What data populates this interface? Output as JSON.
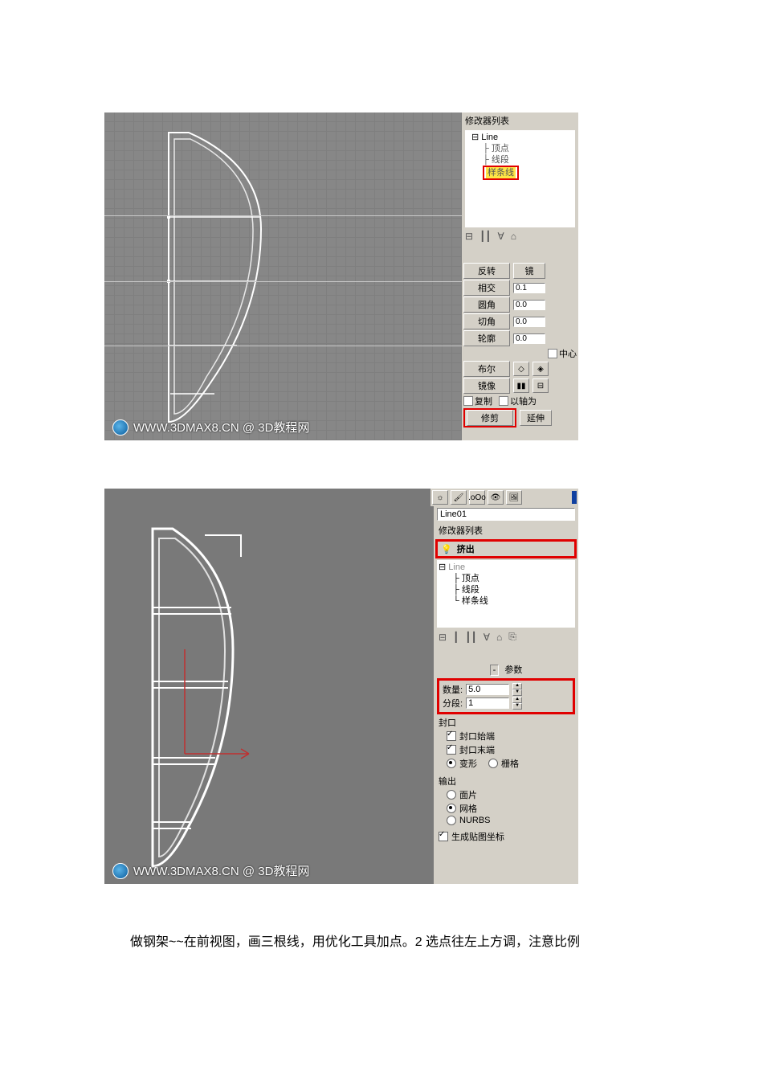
{
  "shot1": {
    "panel_title": "修改器列表",
    "stack": {
      "root": "Line",
      "sub1": "顶点",
      "sub2": "线段",
      "sub3_highlight": "样条线"
    },
    "toolbar_icons": [
      "⊟",
      "┃┃",
      "∀",
      "⌂"
    ],
    "params": {
      "row1_btn": "反转",
      "row1_btn2": "镜",
      "row2_btn": "相交",
      "row2_val": "0.1",
      "row3_btn": "圆角",
      "row3_val": "0.0",
      "row4_btn": "切角",
      "row4_val": "0.0",
      "row5_btn": "轮廓",
      "row5_val": "0.0",
      "row5_chk": "中心",
      "row6_btn": "布尔",
      "row7_btn": "镜像",
      "row8_chk1": "复制",
      "row8_chk2": "以轴为",
      "row9_btn_highlight": "修剪",
      "row9_btn2": "延伸"
    },
    "watermark": "WWW.3DMAX8.CN @ 3D教程网"
  },
  "shot2": {
    "top_icons": [
      "☼",
      "🖌",
      ".oOo",
      "👁",
      "🖼",
      "▮"
    ],
    "obj_name": "Line01",
    "panel_title": "修改器列表",
    "extrude_row": {
      "icon": "💡",
      "label": "挤出"
    },
    "stack": {
      "root": "Line",
      "sub1": "顶点",
      "sub2": "线段",
      "sub3": "样条线"
    },
    "toolbar_icons": [
      "⊟",
      "┃",
      "┃┃",
      "∀",
      "⌂",
      "⎘"
    ],
    "rollout_title": "参数",
    "amount_label": "数量:",
    "amount_val": "5.0",
    "segs_label": "分段:",
    "segs_val": "1",
    "cap_group": "封口",
    "cap_start": "封口始端",
    "cap_end": "封口末端",
    "cap_morph": "变形",
    "cap_grid": "栅格",
    "out_group": "输出",
    "out_patch": "面片",
    "out_mesh": "网格",
    "out_nurbs": "NURBS",
    "gen_map": "生成贴图坐标",
    "watermark": "WWW.3DMAX8.CN @ 3D教程网"
  },
  "body_text": "做钢架~~在前视图，画三根线，用优化工具加点。2 选点往左上方调，注意比例"
}
